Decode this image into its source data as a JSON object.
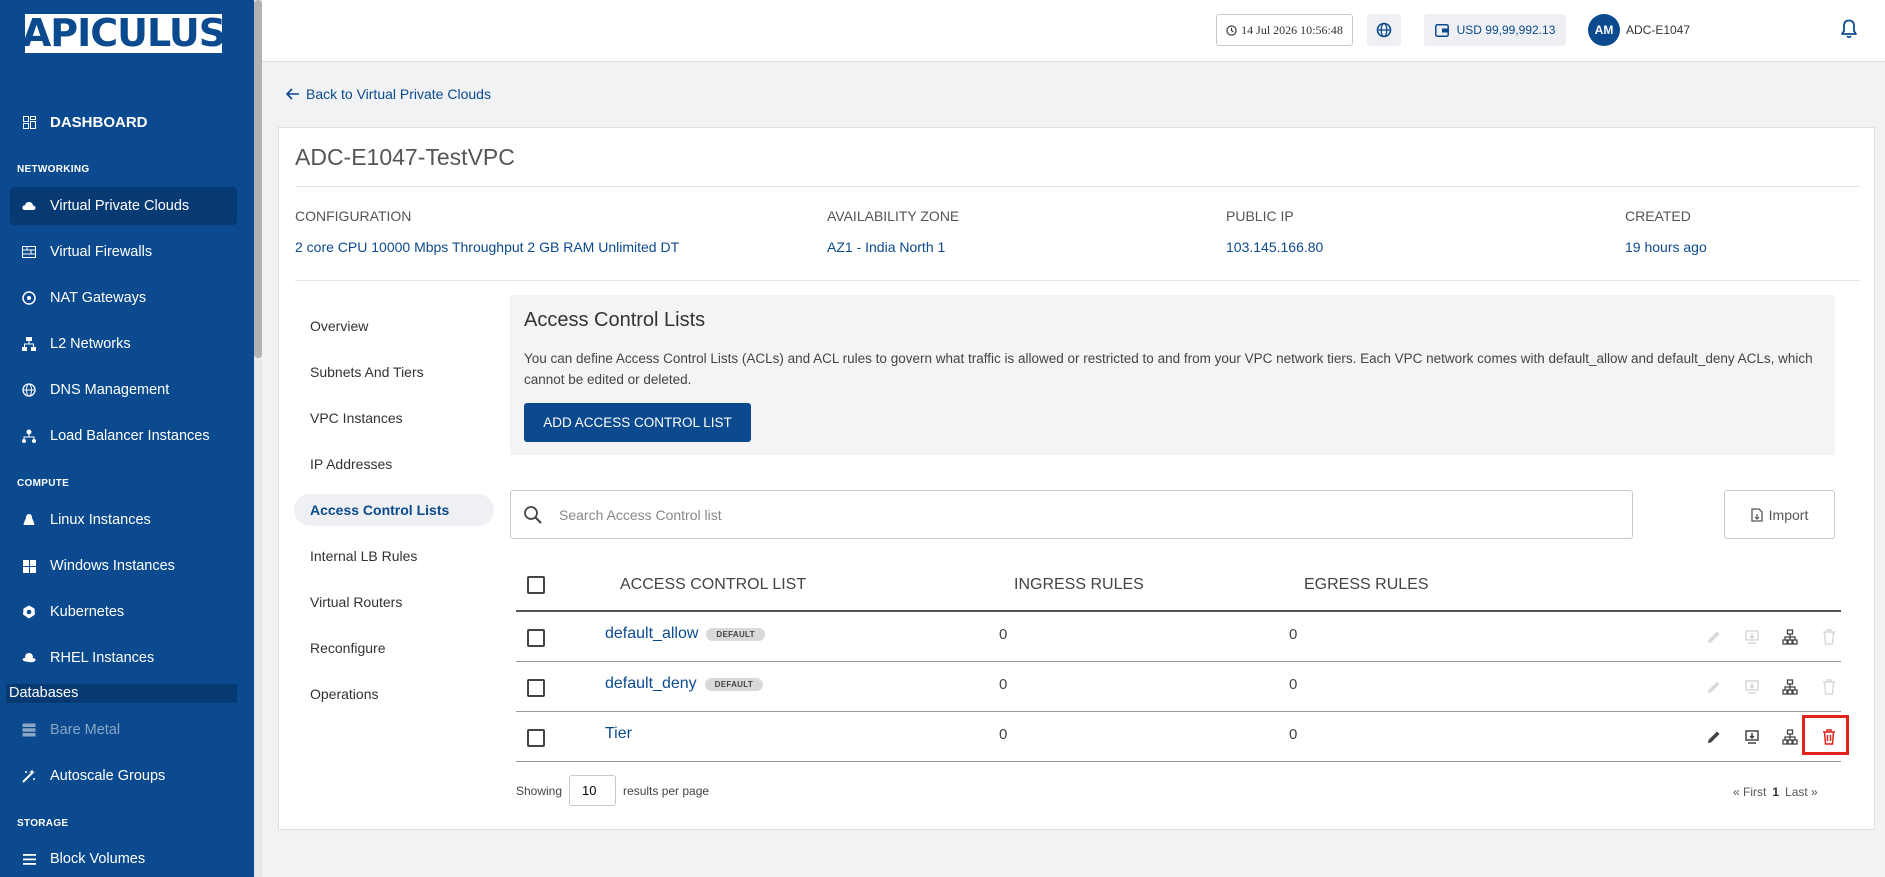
{
  "brand": "APICULUS",
  "sidebar": {
    "dashboard": "DASHBOARD",
    "sections": {
      "networking": "NETWORKING",
      "compute": "COMPUTE",
      "storage": "STORAGE"
    },
    "items": [
      {
        "label": "Virtual Private Clouds",
        "icon": "cloud-icon"
      },
      {
        "label": "Virtual Firewalls",
        "icon": "firewall-icon"
      },
      {
        "label": "NAT Gateways",
        "icon": "nat-gateway-icon"
      },
      {
        "label": "L2 Networks",
        "icon": "network-icon"
      },
      {
        "label": "DNS Management",
        "icon": "globe-icon"
      },
      {
        "label": "Load Balancer Instances",
        "icon": "load-balancer-icon"
      },
      {
        "label": "Linux Instances",
        "icon": "linux-icon"
      },
      {
        "label": "Windows Instances",
        "icon": "windows-icon"
      },
      {
        "label": "Kubernetes",
        "icon": "kubernetes-icon"
      },
      {
        "label": "RHEL Instances",
        "icon": "rhel-icon"
      },
      {
        "label": "Databases",
        "icon": ""
      },
      {
        "label": "Bare Metal",
        "icon": "server-icon"
      },
      {
        "label": "Autoscale Groups",
        "icon": "autoscale-icon"
      },
      {
        "label": "Block Volumes",
        "icon": "volume-icon"
      }
    ]
  },
  "topbar": {
    "datetime": "14 Jul 2026 10:56:48",
    "balance": "USD 99,99,992.13",
    "user_initials": "AM",
    "user_name": "ADC-E1047"
  },
  "back_link": "Back to Virtual Private Clouds",
  "vpc": {
    "title": "ADC-E1047-TestVPC",
    "info": [
      {
        "label": "CONFIGURATION",
        "value": "2 core CPU 10000 Mbps Throughput 2 GB RAM Unlimited DT"
      },
      {
        "label": "AVAILABILITY ZONE",
        "value": "AZ1 - India North 1"
      },
      {
        "label": "PUBLIC IP",
        "value": "103.145.166.80"
      },
      {
        "label": "CREATED",
        "value": "19 hours ago"
      }
    ]
  },
  "tabs": [
    "Overview",
    "Subnets And Tiers",
    "VPC Instances",
    "IP Addresses",
    "Access Control Lists",
    "Internal LB Rules",
    "Virtual Routers",
    "Reconfigure",
    "Operations"
  ],
  "acl": {
    "title": "Access Control Lists",
    "description": "You can define Access Control Lists (ACLs) and ACL rules to govern what traffic is allowed or restricted to and from your VPC network tiers. Each VPC network comes with default_allow and default_deny ACLs, which cannot be edited or deleted.",
    "add_button": "ADD ACCESS CONTROL LIST",
    "search_placeholder": "Search Access Control list",
    "import_label": "Import",
    "columns": [
      "ACCESS CONTROL LIST",
      "INGRESS RULES",
      "EGRESS RULES"
    ],
    "rows": [
      {
        "name": "default_allow",
        "badge": "DEFAULT",
        "ingress": "0",
        "egress": "0"
      },
      {
        "name": "default_deny",
        "badge": "DEFAULT",
        "ingress": "0",
        "egress": "0"
      },
      {
        "name": "Tier",
        "badge": "",
        "ingress": "0",
        "egress": "0"
      }
    ],
    "pagination": {
      "showing": "Showing",
      "per_page": "10",
      "results_per_page": "results per page",
      "first": "« First",
      "current": "1",
      "last": "Last »"
    }
  },
  "colors": {
    "primary": "#0b4a8e",
    "danger": "#e0241b"
  }
}
